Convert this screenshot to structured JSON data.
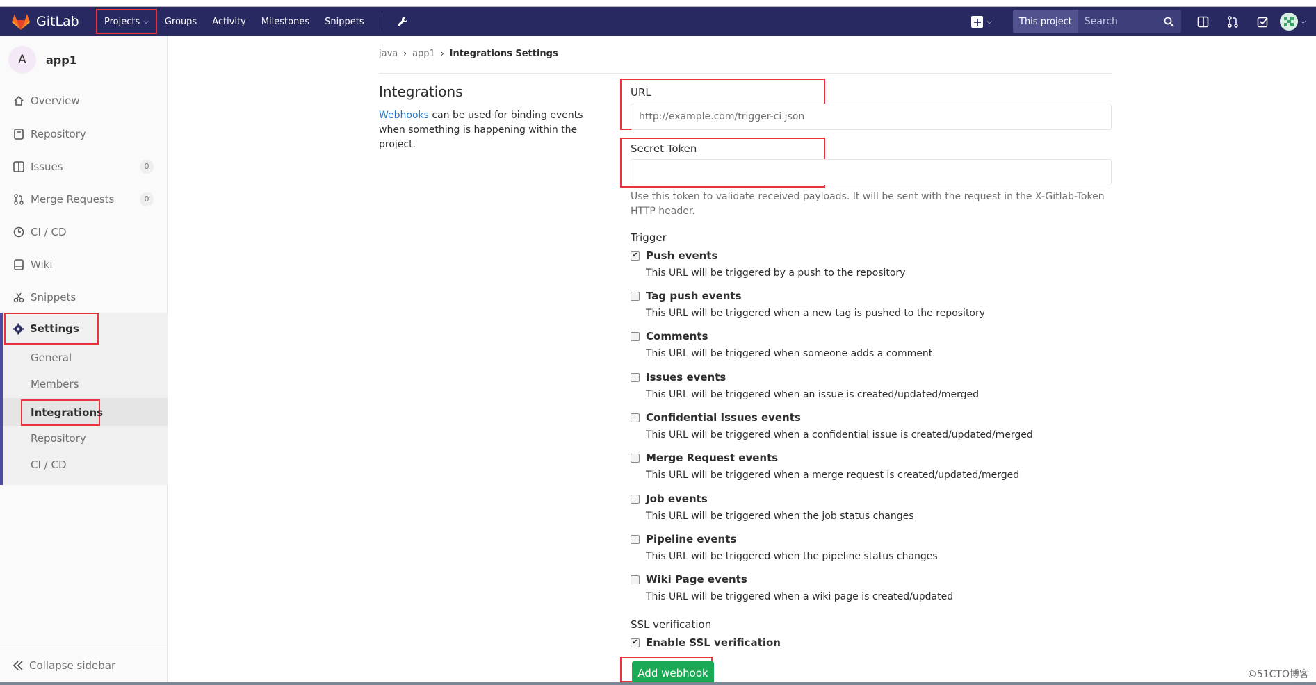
{
  "nav": {
    "brand": "GitLab",
    "projects": "Projects",
    "items": [
      "Groups",
      "Activity",
      "Milestones",
      "Snippets"
    ],
    "search_scope": "This project",
    "search_placeholder": "Search"
  },
  "sidebar": {
    "project_initial": "A",
    "project_name": "app1",
    "items": [
      {
        "label": "Overview"
      },
      {
        "label": "Repository"
      },
      {
        "label": "Issues",
        "count": "0"
      },
      {
        "label": "Merge Requests",
        "count": "0"
      },
      {
        "label": "CI / CD"
      },
      {
        "label": "Wiki"
      },
      {
        "label": "Snippets"
      }
    ],
    "settings": "Settings",
    "settings_sub": [
      "General",
      "Members",
      "Integrations",
      "Repository",
      "CI / CD"
    ],
    "collapse": "Collapse sidebar"
  },
  "breadcrumb": [
    "java",
    "app1",
    "Integrations Settings"
  ],
  "intro": {
    "title": "Integrations",
    "link": "Webhooks",
    "text": " can be used for binding events when something is happening within the project."
  },
  "form": {
    "url_label": "URL",
    "url_placeholder": "http://example.com/trigger-ci.json",
    "token_label": "Secret Token",
    "token_hint": "Use this token to validate received payloads. It will be sent with the request in the X-Gitlab-Token HTTP header.",
    "trigger_label": "Trigger",
    "triggers": [
      {
        "title": "Push events",
        "desc": "This URL will be triggered by a push to the repository",
        "checked": true
      },
      {
        "title": "Tag push events",
        "desc": "This URL will be triggered when a new tag is pushed to the repository",
        "checked": false
      },
      {
        "title": "Comments",
        "desc": "This URL will be triggered when someone adds a comment",
        "checked": false
      },
      {
        "title": "Issues events",
        "desc": "This URL will be triggered when an issue is created/updated/merged",
        "checked": false
      },
      {
        "title": "Confidential Issues events",
        "desc": "This URL will be triggered when a confidential issue is created/updated/merged",
        "checked": false
      },
      {
        "title": "Merge Request events",
        "desc": "This URL will be triggered when a merge request is created/updated/merged",
        "checked": false
      },
      {
        "title": "Job events",
        "desc": "This URL will be triggered when the job status changes",
        "checked": false
      },
      {
        "title": "Pipeline events",
        "desc": "This URL will be triggered when the pipeline status changes",
        "checked": false
      },
      {
        "title": "Wiki Page events",
        "desc": "This URL will be triggered when a wiki page is created/updated",
        "checked": false
      }
    ],
    "ssl_label": "SSL verification",
    "ssl_option": "Enable SSL verification",
    "ssl_checked": true,
    "submit": "Add webhook"
  },
  "watermark": "©51CTO博客"
}
